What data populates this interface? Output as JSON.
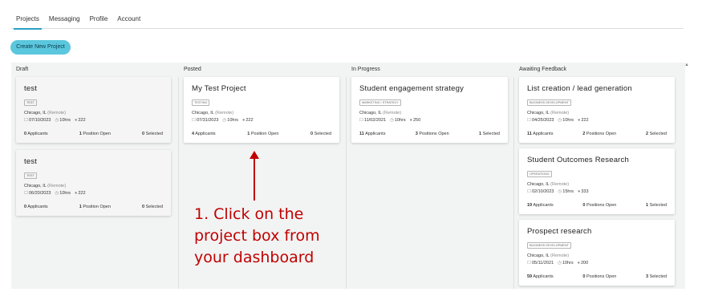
{
  "tabs": [
    {
      "label": "Projects",
      "active": true
    },
    {
      "label": "Messaging",
      "active": false
    },
    {
      "label": "Profile",
      "active": false
    },
    {
      "label": "Account",
      "active": false
    }
  ],
  "create_button": "Create New Project",
  "columns": [
    {
      "title": "Draft"
    },
    {
      "title": "Posted"
    },
    {
      "title": "In Progress"
    },
    {
      "title": "Awaiting Feedback"
    }
  ],
  "remote_label": "(Remote)",
  "cards": {
    "draft1": {
      "title": "test",
      "tag": "TEST",
      "location": "Chicago, IL",
      "date": "07/10/2023",
      "hours": "10hrs",
      "count": "222",
      "applicants": "0",
      "applicants_label": "Applicants",
      "positions": "1",
      "positions_label": "Position Open",
      "selected": "0",
      "selected_label": "Selected"
    },
    "draft2": {
      "title": "test",
      "tag": "TEST",
      "location": "Chicago, IL",
      "date": "06/20/2023",
      "hours": "10hrs",
      "count": "222",
      "applicants": "0",
      "applicants_label": "Applicants",
      "positions": "1",
      "positions_label": "Position Open",
      "selected": "0",
      "selected_label": "Selected"
    },
    "posted1": {
      "title": "My Test Project",
      "tag": "TESTING",
      "location": "Chicago, IL",
      "date": "07/31/2023",
      "hours": "10hrs",
      "count": "222",
      "applicants": "4",
      "applicants_label": "Applicants",
      "positions": "1",
      "positions_label": "Position Open",
      "selected": "0",
      "selected_label": "Selected"
    },
    "progress1": {
      "title": "Student engagement strategy",
      "tag": "MARKETING / STRATEGY",
      "location": "Chicago, IL",
      "date": "11/02/2021",
      "hours": "10hrs",
      "count": "250",
      "applicants": "11",
      "applicants_label": "Applicants",
      "positions": "3",
      "positions_label": "Positions Open",
      "selected": "1",
      "selected_label": "Selected"
    },
    "feedback1": {
      "title": "List creation / lead generation",
      "tag": "BUSINESS DEVELOPMENT",
      "location": "Chicago, IL",
      "date": "04/25/2023",
      "hours": "10hrs",
      "count": "222",
      "applicants": "11",
      "applicants_label": "Applicants",
      "positions": "2",
      "positions_label": "Positions Open",
      "selected": "2",
      "selected_label": "Selected"
    },
    "feedback2": {
      "title": "Student Outcomes Research",
      "tag": "OPERATIONS",
      "location": "Chicago, IL",
      "date": "02/10/2023",
      "hours": "15hrs",
      "count": "333",
      "applicants": "19",
      "applicants_label": "Applicants",
      "positions": "0",
      "positions_label": "Positions Open",
      "selected": "1",
      "selected_label": "Selected"
    },
    "feedback3": {
      "title": "Prospect research",
      "tag": "BUSINESS DEVELOPMENT",
      "location": "Chicago, IL",
      "date": "05/11/2021",
      "hours": "10hrs",
      "count": "200",
      "applicants": "59",
      "applicants_label": "Applicants",
      "positions": "0",
      "positions_label": "Positions Open",
      "selected": "3",
      "selected_label": "Selected"
    }
  },
  "annotation": {
    "line1": "1. Click on the",
    "line2": "project box from",
    "line3": "your dashboard",
    "color": "#c00000"
  },
  "colors": {
    "accent": "#5bc7de",
    "tab_underline": "#2a9fc4",
    "board_bg": "#f2f3f3"
  },
  "icons": {
    "calendar": "calendar-icon",
    "clock": "clock-icon",
    "coin": "coin-icon"
  }
}
